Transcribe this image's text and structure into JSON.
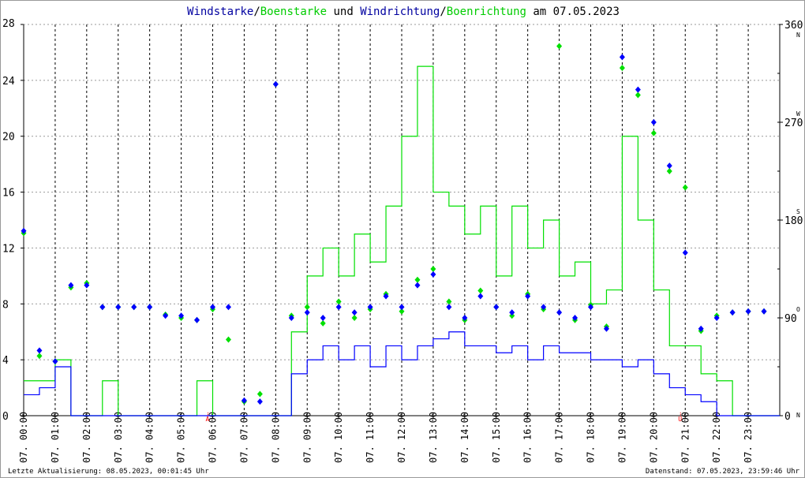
{
  "chart_data": {
    "type": "line",
    "title_parts": [
      {
        "text": "Windstarke",
        "color": "#0000a0"
      },
      {
        "text": "/",
        "color": "#000000"
      },
      {
        "text": "Boenstarke",
        "color": "#00cc00"
      },
      {
        "text": " und ",
        "color": "#000000"
      },
      {
        "text": "Windrichtung",
        "color": "#0000a0"
      },
      {
        "text": "/",
        "color": "#000000"
      },
      {
        "text": "Boenrichtung",
        "color": "#00cc00"
      },
      {
        "text": " am 07.05.2023",
        "color": "#000000"
      }
    ],
    "x_unit": "hour",
    "x_range": [
      0,
      24
    ],
    "x_tick_labels": [
      "07. 00:00",
      "07. 01:00",
      "07. 02:00",
      "07. 03:00",
      "07. 04:00",
      "07. 05:00",
      "07. 06:00",
      "07. 07:00",
      "07. 08:00",
      "07. 09:00",
      "07. 10:00",
      "07. 11:00",
      "07. 12:00",
      "07. 13:00",
      "07. 14:00",
      "07. 15:00",
      "07. 16:00",
      "07. 17:00",
      "07. 18:00",
      "07. 19:00",
      "07. 20:00",
      "07. 21:00",
      "07. 22:00",
      "07. 23:00"
    ],
    "y_left": {
      "range": [
        0,
        28
      ],
      "ticks": [
        "0",
        "4",
        "8",
        "12",
        "16",
        "20",
        "24",
        "28"
      ]
    },
    "y_right": {
      "range": [
        0,
        360
      ],
      "ticks": [
        "0",
        "90",
        "180",
        "270",
        "360"
      ],
      "compass": [
        "N",
        "O",
        "S",
        "W",
        "N"
      ]
    },
    "sun_markers": [
      {
        "label": "A",
        "hour": 5.85
      },
      {
        "label": "U",
        "hour": 20.85
      }
    ],
    "x": [
      0,
      0.5,
      1,
      1.5,
      2,
      2.5,
      3,
      3.5,
      4,
      4.5,
      5,
      5.5,
      6,
      6.5,
      7,
      7.5,
      8,
      8.5,
      9,
      9.5,
      10,
      10.5,
      11,
      11.5,
      12,
      12.5,
      13,
      13.5,
      14,
      14.5,
      15,
      15.5,
      16,
      16.5,
      17,
      17.5,
      18,
      18.5,
      19,
      19.5,
      20,
      20.5,
      21,
      21.5,
      22,
      22.5,
      23,
      23.5
    ],
    "series": [
      {
        "name": "Boenstarke",
        "axis": "left",
        "color": "#00e000",
        "values": [
          2.5,
          2.5,
          4,
          0,
          0,
          2.5,
          0,
          0,
          0,
          0,
          0,
          2.5,
          0,
          0,
          0,
          0,
          0,
          6,
          10,
          12,
          10,
          13,
          11,
          15,
          20,
          25,
          16,
          15,
          13,
          15,
          10,
          15,
          12,
          14,
          10,
          11,
          8,
          9,
          20,
          14,
          9,
          5,
          5,
          3,
          2.5,
          0,
          0,
          0
        ]
      },
      {
        "name": "Windstarke",
        "axis": "left",
        "color": "#0000ff",
        "values": [
          1.5,
          2,
          3.5,
          0,
          0,
          0,
          0,
          0,
          0,
          0,
          0,
          0,
          0,
          0,
          0,
          0,
          0,
          3,
          4,
          5,
          4,
          5,
          3.5,
          5,
          4,
          5,
          5.5,
          6,
          5,
          5,
          4.5,
          5,
          4,
          5,
          4.5,
          4.5,
          4,
          4,
          3.5,
          4,
          3,
          2,
          1.5,
          1,
          0,
          0,
          0,
          0
        ]
      },
      {
        "name": "Boenrichtung",
        "axis": "right",
        "color": "#00e000",
        "marker": "diamond",
        "values": [
          168,
          55,
          50,
          118,
          122,
          100,
          100,
          100,
          100,
          93,
          90,
          88,
          98,
          70,
          13,
          20,
          305,
          92,
          100,
          85,
          105,
          90,
          98,
          112,
          96,
          125,
          135,
          105,
          88,
          115,
          100,
          92,
          112,
          98,
          340,
          88,
          102,
          82,
          320,
          295,
          260,
          225,
          210,
          78,
          92,
          95,
          96,
          96
        ]
      },
      {
        "name": "Windrichtung",
        "axis": "right",
        "color": "#0000ff",
        "marker": "diamond",
        "values": [
          170,
          60,
          50,
          120,
          120,
          100,
          100,
          100,
          100,
          92,
          92,
          88,
          100,
          100,
          14,
          13,
          305,
          90,
          95,
          90,
          100,
          95,
          100,
          110,
          100,
          120,
          130,
          100,
          90,
          110,
          100,
          95,
          110,
          100,
          95,
          90,
          100,
          80,
          330,
          300,
          270,
          230,
          150,
          80,
          90,
          95,
          96,
          96
        ]
      }
    ]
  },
  "footer": {
    "left": "Letzte Aktualisierung: 08.05.2023, 00:01:45 Uhr",
    "right": "Datenstand: 07.05.2023, 23:59:46 Uhr"
  }
}
